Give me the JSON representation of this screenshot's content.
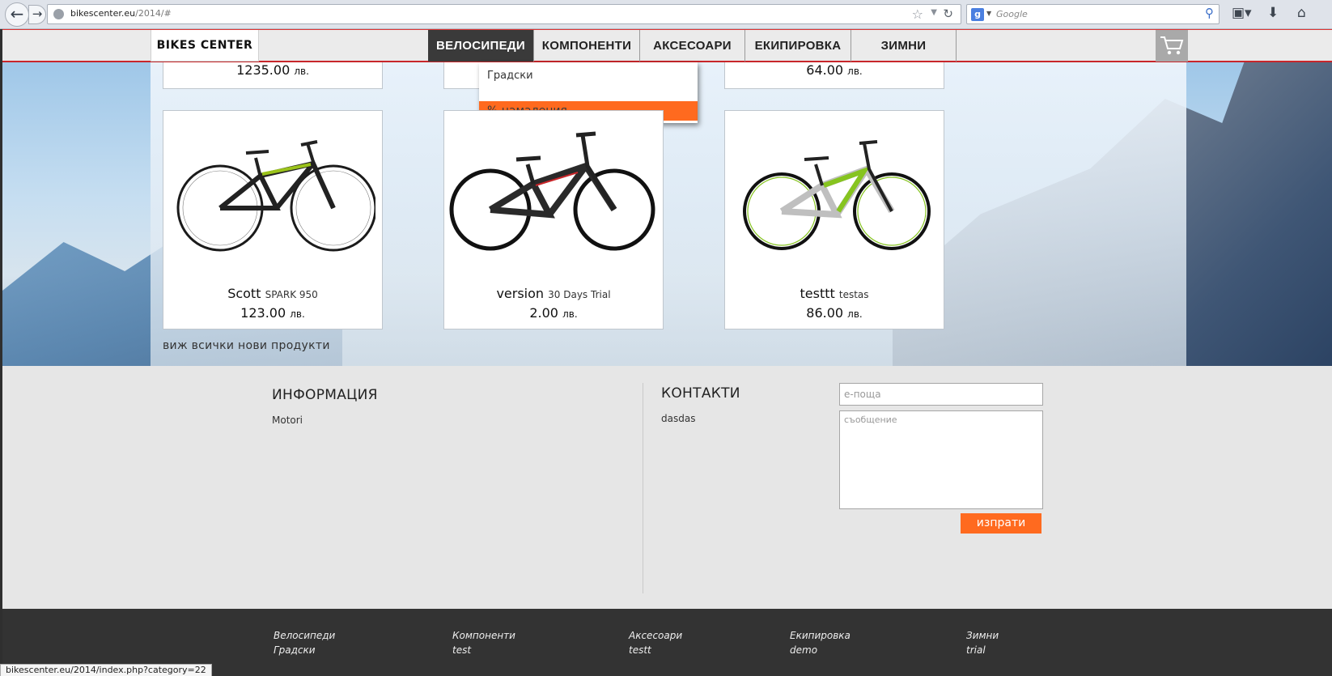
{
  "browser": {
    "url_host": "bikescenter.eu",
    "url_path": "/2014/#",
    "search_placeholder": "Google",
    "search_engine_badge": "g"
  },
  "header": {
    "logo": "BIKES CENTER",
    "menu": [
      {
        "label": "ВЕЛОСИПЕДИ",
        "active": true
      },
      {
        "label": "КОМПОНЕНТИ",
        "active": false
      },
      {
        "label": "АКСЕСОАРИ",
        "active": false
      },
      {
        "label": "ЕКИПИРОВКА",
        "active": false
      },
      {
        "label": "ЗИМНИ",
        "active": false
      }
    ],
    "cart_icon": "cart-icon"
  },
  "dropdown": {
    "items": [
      "Градски",
      "% намаления"
    ],
    "highlight_color": "#ff6a1f"
  },
  "top_row_prices": [
    {
      "price": "1235.00",
      "currency": "лв."
    },
    {
      "price": "64.00",
      "currency": "лв."
    }
  ],
  "products": [
    {
      "brand": "Scott",
      "model": "SPARK 950",
      "price": "123.00",
      "currency": "лв.",
      "frame_color": "#9bc31b"
    },
    {
      "brand": "version",
      "model": "30 Days Trial",
      "price": "2.00",
      "currency": "лв.",
      "frame_color": "#2a2a2a"
    },
    {
      "brand": "testtt",
      "model": "testas",
      "price": "86.00",
      "currency": "лв.",
      "frame_color": "#86c41f"
    }
  ],
  "see_all": "виж всички нови продукти",
  "info": {
    "title": "ИНФОРМАЦИЯ",
    "text": "Motori"
  },
  "contacts": {
    "title": "КОНТАКТИ",
    "text": "dasdas",
    "email_placeholder": "е-поща",
    "message_placeholder": "съобщение",
    "send_label": "изпрати"
  },
  "footer_links": [
    {
      "category": "Велосипеди",
      "sub": "Градски"
    },
    {
      "category": "Компоненти",
      "sub": "test"
    },
    {
      "category": "Аксесоари",
      "sub": "testt"
    },
    {
      "category": "Екипировка",
      "sub": "demo"
    },
    {
      "category": "Зимни",
      "sub": "trial"
    }
  ],
  "status_url": "bikescenter.eu/2014/index.php?category=22",
  "colors": {
    "accent": "#ff6a1f",
    "header_border": "#c8262a",
    "footer_dark": "#333333"
  }
}
